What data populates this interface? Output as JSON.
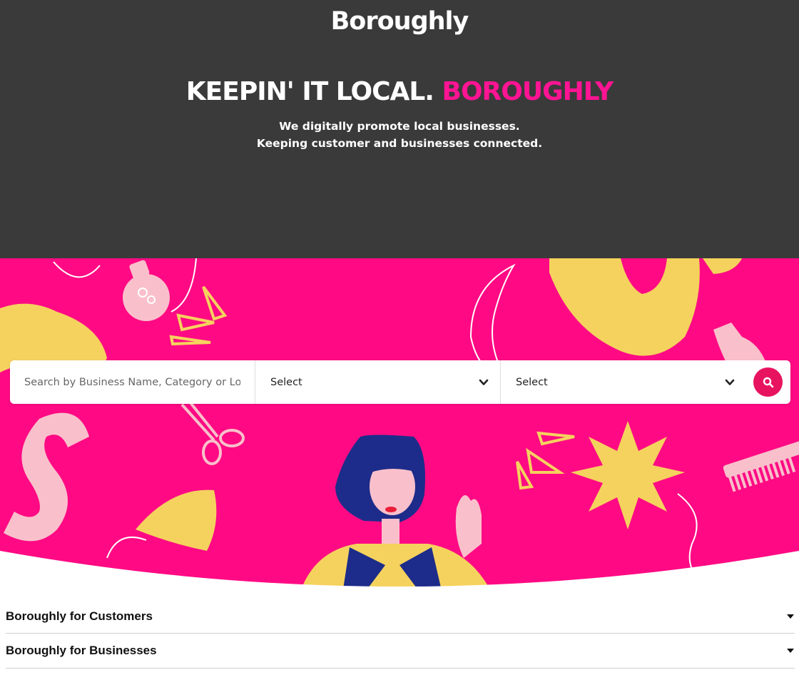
{
  "header": {
    "logo": "Boroughly"
  },
  "hero": {
    "headline_main": "KEEPIN' IT LOCAL.",
    "headline_accent": "BOROUGHLY",
    "subline_1": "We digitally promote local businesses.",
    "subline_2": "Keeping customer and businesses connected."
  },
  "search": {
    "placeholder": "Search by Business Name, Category or Location",
    "select_1": "Select",
    "select_2": "Select",
    "button_icon": "search-icon"
  },
  "accordion": {
    "items": [
      {
        "title": "Boroughly for Customers",
        "icon": "caret-down-icon"
      },
      {
        "title": "Boroughly for Businesses",
        "icon": "caret-down-icon"
      }
    ]
  },
  "colors": {
    "dark_bg": "#3a3a3a",
    "accent_pink": "#ff1493",
    "band_pink": "#ff0a84",
    "search_button": "#e8135f",
    "yellow": "#f5d25e",
    "light_pink": "#f9c0cb"
  }
}
